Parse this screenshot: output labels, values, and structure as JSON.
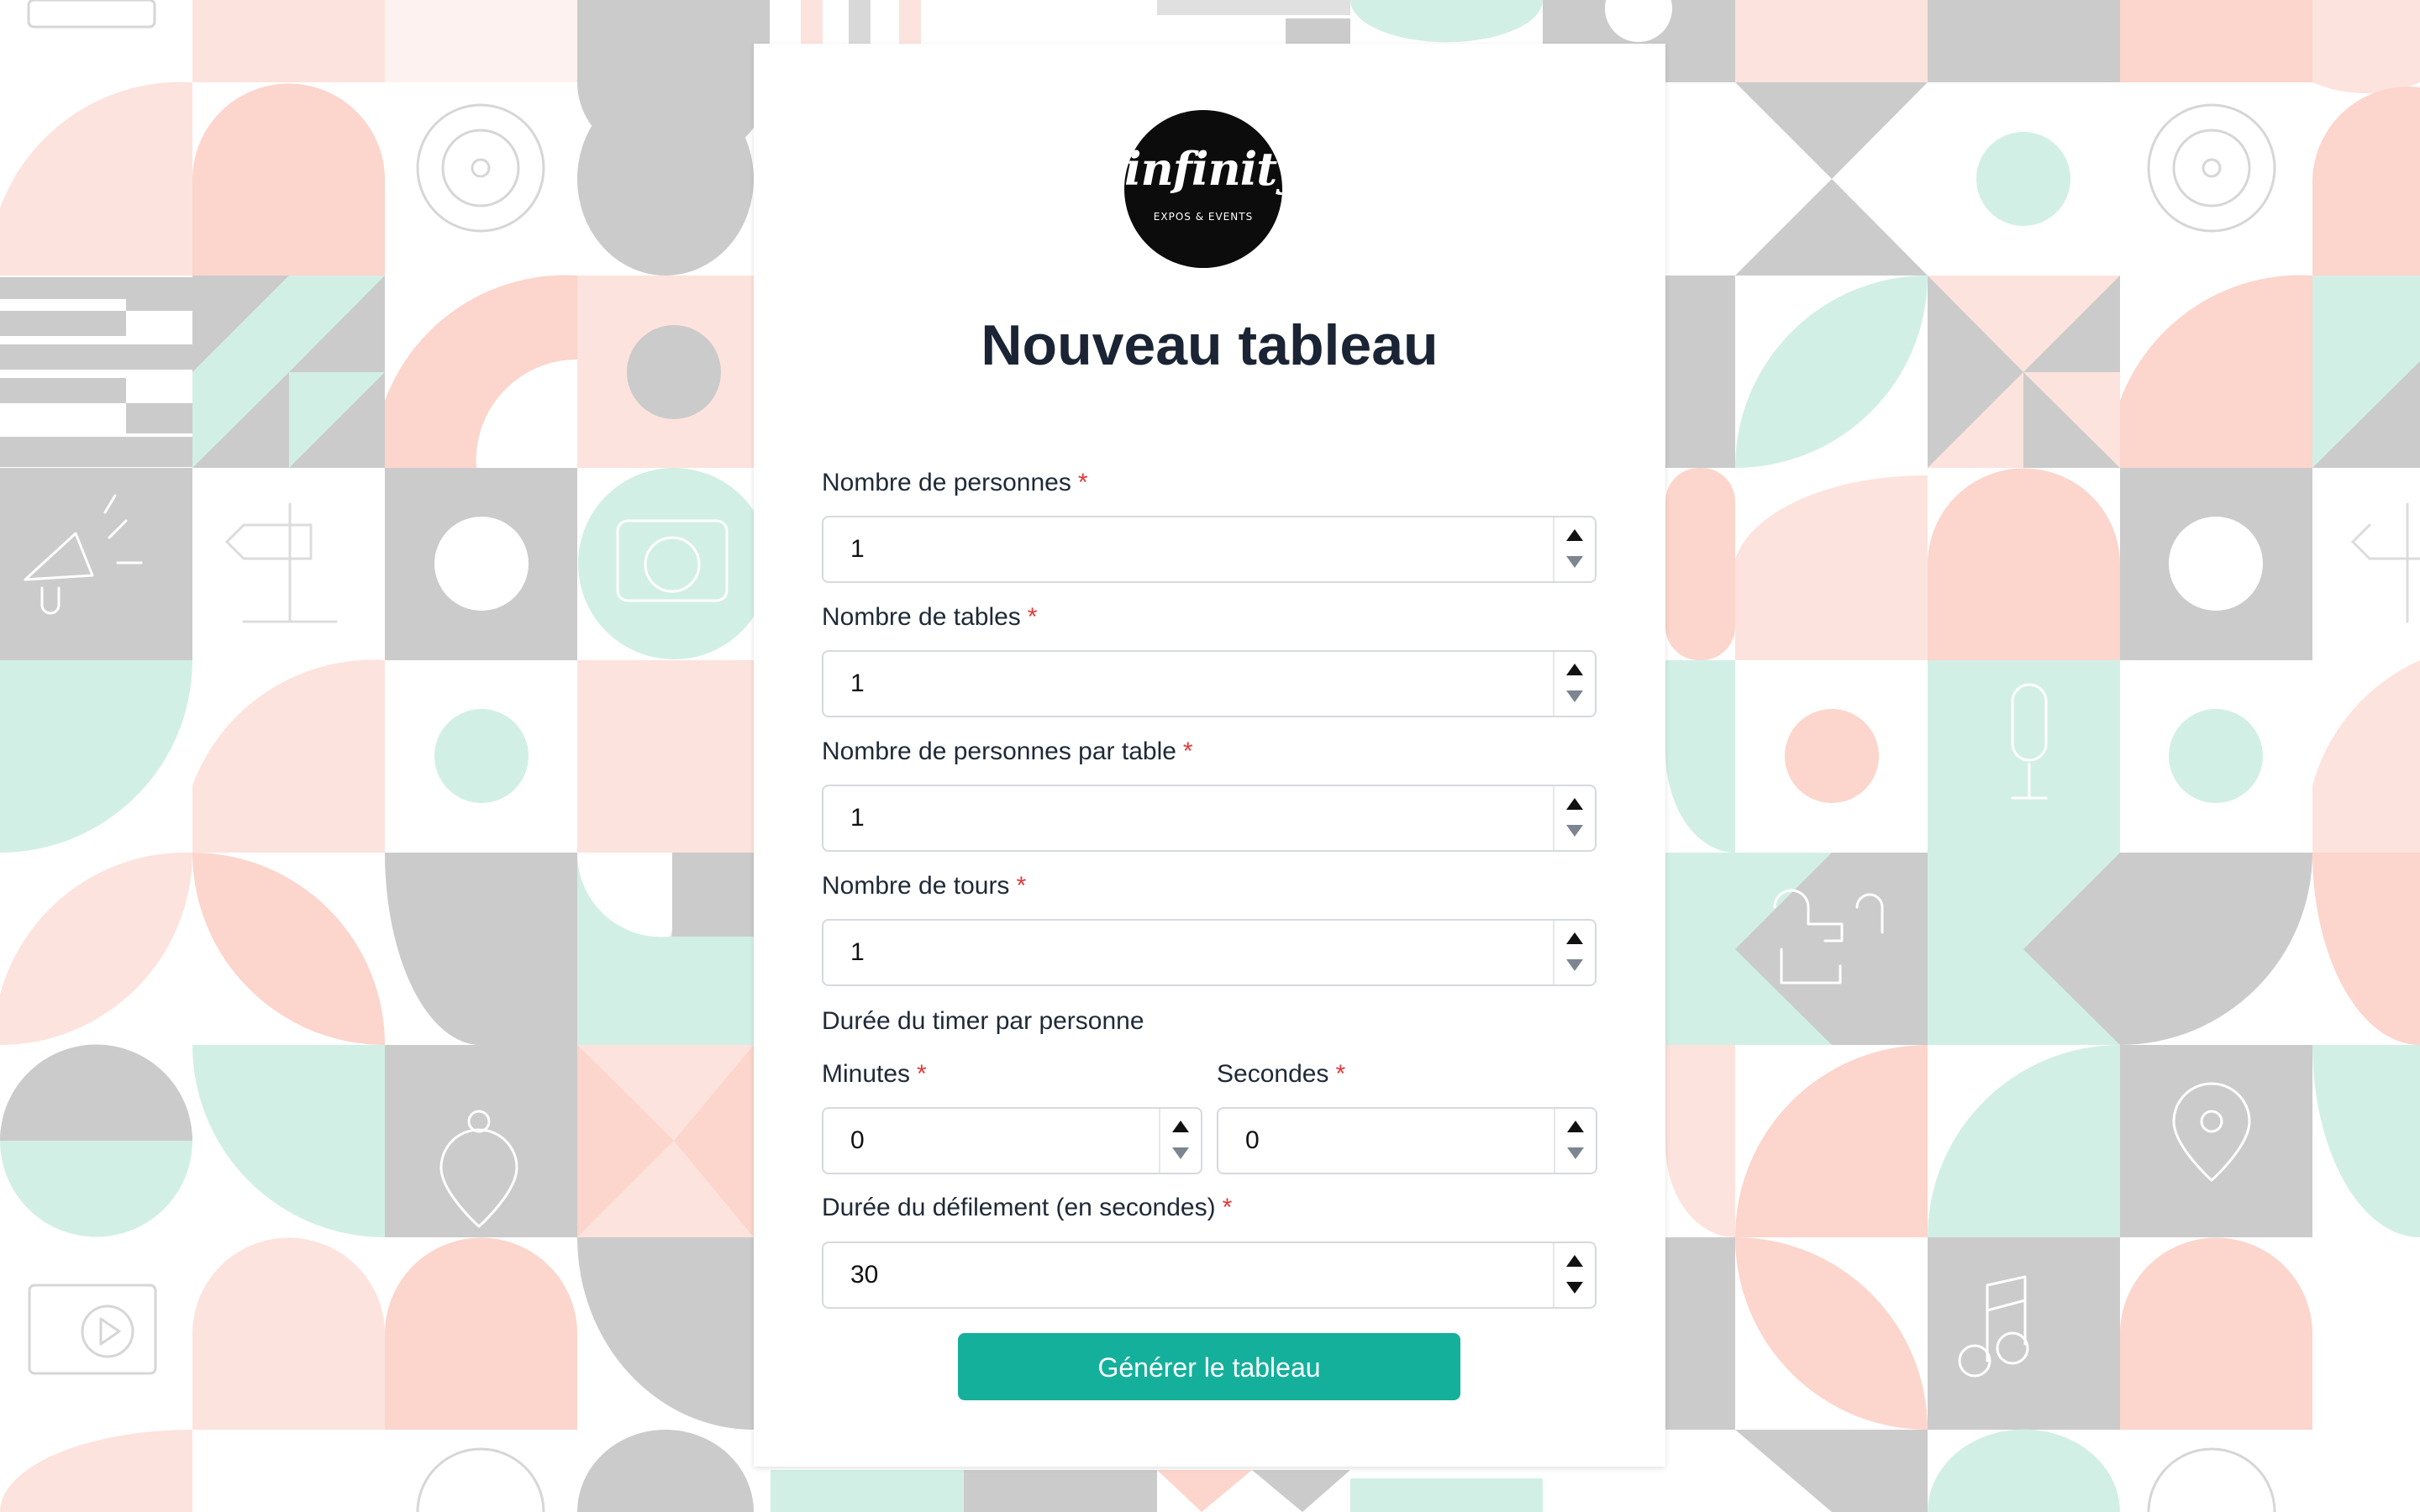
{
  "logo": {
    "main": "infinity",
    "sub": "EXPOS & EVENTS"
  },
  "title": "Nouveau tableau",
  "required_mark": "*",
  "fields": {
    "personnes": {
      "label": "Nombre de personnes",
      "value": "1"
    },
    "tables": {
      "label": "Nombre de tables",
      "value": "1"
    },
    "par_table": {
      "label": "Nombre de personnes par table",
      "value": "1"
    },
    "tours": {
      "label": "Nombre de tours",
      "value": "1"
    },
    "timer_heading": "Durée du timer par personne",
    "minutes": {
      "label": "Minutes",
      "value": "0"
    },
    "secondes": {
      "label": "Secondes",
      "value": "0"
    },
    "defilement": {
      "label": "Durée du défilement (en secondes)",
      "value": "30"
    }
  },
  "submit_label": "Générer le tableau",
  "colors": {
    "accent": "#14b09c",
    "required": "#e03a3a",
    "pattern_pink": "#fcd5cc",
    "pattern_mint": "#d2efe6",
    "pattern_gray": "#cbcbcb"
  }
}
